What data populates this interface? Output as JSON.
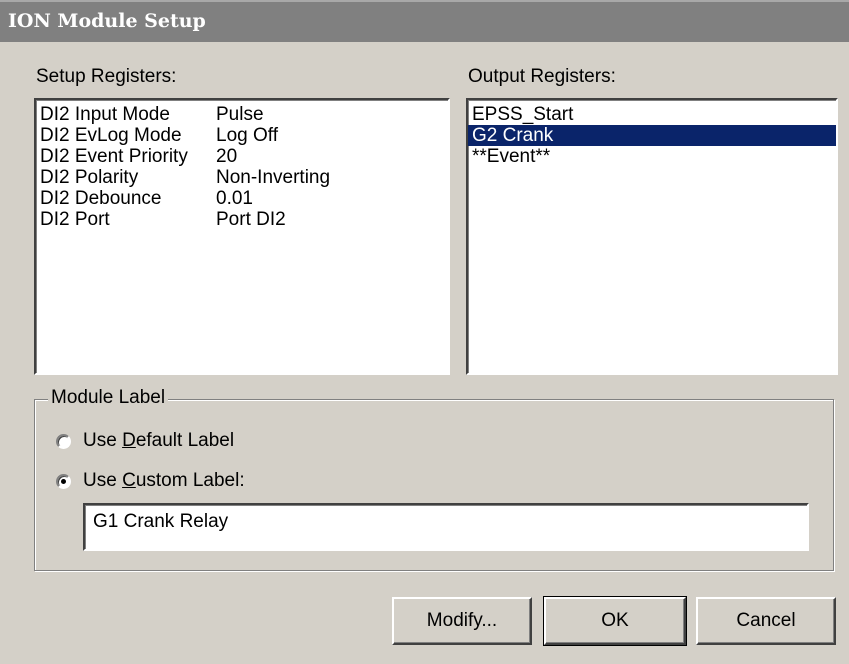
{
  "window": {
    "title": "ION Module Setup"
  },
  "setup_registers": {
    "label": "Setup Registers:",
    "rows": [
      {
        "name": "DI2 Input Mode",
        "value": "Pulse"
      },
      {
        "name": "DI2 EvLog Mode",
        "value": "Log Off"
      },
      {
        "name": "DI2 Event Priority",
        "value": "20"
      },
      {
        "name": "DI2 Polarity",
        "value": "Non-Inverting"
      },
      {
        "name": "DI2 Debounce",
        "value": "0.01"
      },
      {
        "name": "DI2 Port",
        "value": "Port DI2"
      }
    ]
  },
  "output_registers": {
    "label": "Output Registers:",
    "items": [
      "EPSS_Start",
      "G2 Crank",
      "**Event**"
    ],
    "selected": "G2 Crank"
  },
  "module_label": {
    "legend": "Module Label",
    "default_option": {
      "prefix": "Use ",
      "accel": "D",
      "rest": "efault Label"
    },
    "custom_option": {
      "prefix": "Use ",
      "accel": "C",
      "rest": "ustom Label:"
    },
    "selected_option": "custom",
    "custom_value": "G1 Crank Relay"
  },
  "buttons": {
    "modify": "Modify...",
    "ok": "OK",
    "cancel": "Cancel"
  }
}
